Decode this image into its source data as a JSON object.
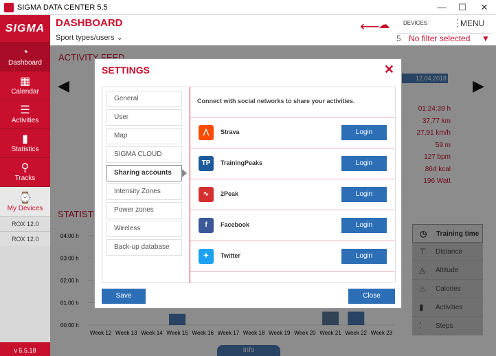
{
  "window": {
    "title": "SIGMA DATA CENTER 5.5",
    "minimize": "—",
    "maximize": "☐",
    "close": "✕"
  },
  "sidebar": {
    "logo": "SIGMA",
    "items": [
      {
        "label": "Dashboard",
        "icon": "gauge-icon",
        "glyph": "◔"
      },
      {
        "label": "Calendar",
        "icon": "calendar-icon",
        "glyph": "▦"
      },
      {
        "label": "Activities",
        "icon": "list-icon",
        "glyph": "☰"
      },
      {
        "label": "Statistics",
        "icon": "bar-chart-icon",
        "glyph": "▮"
      },
      {
        "label": "Tracks",
        "icon": "map-pin-icon",
        "glyph": "⚲"
      }
    ],
    "my_devices": {
      "label": "My Devices",
      "glyph": "⌚"
    },
    "devices": [
      "ROX 12.0",
      "ROX 12.0"
    ],
    "version": "v 5.5.18"
  },
  "header": {
    "title": "DASHBOARD",
    "sport_types": "Sport types/users",
    "devices_label": "DEVICES",
    "menu_label": "MENU",
    "filter_count": "5",
    "filter_text": "No filter selected"
  },
  "background": {
    "activity_feed": "ACTIVITY FEED",
    "statistics": "STATISTI",
    "date": "12.04.2018",
    "values": [
      "01:24:39  h",
      "37,77  km",
      "27,91  km/h",
      "59  m",
      "127  bpm",
      "864  kcal",
      "196  Watt"
    ],
    "info_tab": "Info"
  },
  "right_menu": [
    {
      "label": "Training time",
      "glyph": "◷",
      "selected": true
    },
    {
      "label": "Distance",
      "glyph": "⊤",
      "selected": false
    },
    {
      "label": "Altitude",
      "glyph": "◬",
      "selected": false
    },
    {
      "label": "Calories",
      "glyph": "♨",
      "selected": false
    },
    {
      "label": "Activities",
      "glyph": "▮",
      "selected": false
    },
    {
      "label": "Steps",
      "glyph": "⁚",
      "selected": false
    }
  ],
  "chart_data": {
    "type": "bar",
    "categories": [
      "Week 12",
      "Week 13",
      "Week 14",
      "Week 15",
      "Week 16",
      "Week 17",
      "Week 18",
      "Week 19",
      "Week 20",
      "Week 21",
      "Week 22",
      "Week 23"
    ],
    "values": [
      0,
      0,
      0,
      0.5,
      0,
      0,
      0,
      0,
      0,
      0.6,
      0.6,
      0
    ],
    "yticks": [
      "04:00 h",
      "03:00 h",
      "02:00 h",
      "01:00 h",
      "00:00 h"
    ],
    "ylim": [
      0,
      4
    ]
  },
  "modal": {
    "title": "SETTINGS",
    "tabs": [
      "General",
      "User",
      "Map",
      "SIGMA CLOUD",
      "Sharing accounts",
      "Intensity Zones",
      "Power zones",
      "Wireless",
      "Back-up database"
    ],
    "active_tab": 4,
    "intro": "Connect with social networks to share your activities.",
    "accounts": [
      {
        "name": "Strava",
        "button": "Login",
        "color": "#fc4c02",
        "glyph": "⋀",
        "icon": "strava-icon"
      },
      {
        "name": "TrainingPeaks",
        "button": "Login",
        "color": "#1d5a9c",
        "glyph": "TP",
        "icon": "trainingpeaks-icon"
      },
      {
        "name": "2Peak",
        "button": "Login",
        "color": "#d62f2f",
        "glyph": "∿",
        "icon": "2peak-icon"
      },
      {
        "name": "Facebook",
        "button": "Login",
        "color": "#3b5998",
        "glyph": "f",
        "icon": "facebook-icon"
      },
      {
        "name": "Twitter",
        "button": "Login",
        "color": "#1da1f2",
        "glyph": "✦",
        "icon": "twitter-icon"
      }
    ],
    "save": "Save",
    "close": "Close"
  }
}
